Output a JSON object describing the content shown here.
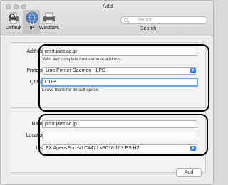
{
  "window": {
    "title": "Add"
  },
  "toolbar": {
    "items": [
      {
        "label": "Default",
        "icon": "default-printer-icon"
      },
      {
        "label": "IP",
        "icon": "ip-globe-icon",
        "selected": true
      },
      {
        "label": "Windows",
        "icon": "windows-printer-icon"
      }
    ],
    "search": {
      "placeholder": "Search",
      "caption": "Search"
    }
  },
  "connection": {
    "address_label": "Address:",
    "address_value": "print.jaist.ac.jp",
    "address_hint": "Valid and complete host name or address.",
    "protocol_label": "Protocol:",
    "protocol_value": "Line Printer Daemon - LPD",
    "queue_label": "Queue:",
    "queue_value": "ODP",
    "queue_hint": "Leave blank for default queue."
  },
  "details": {
    "name_label": "Name:",
    "name_value": "print.jaist.ac.jp",
    "location_label": "Location:",
    "location_value": "",
    "use_label": "Use:",
    "use_value": "FX ApeosPort-VI C4471 v3018.103 PS H2"
  },
  "actions": {
    "add_label": "Add"
  },
  "colors": {
    "accent": "#2f7ff0",
    "focus_ring": "#6fa8e8",
    "annotation": "#000000"
  }
}
